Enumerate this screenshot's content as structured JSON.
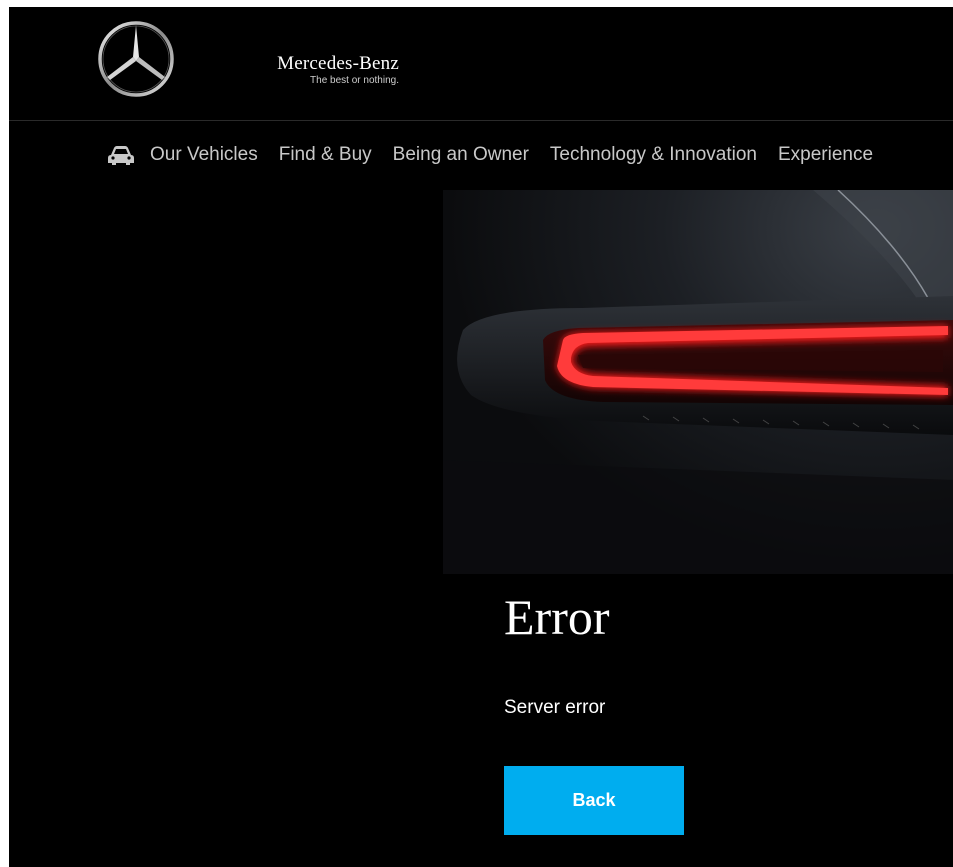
{
  "header": {
    "brand_name": "Mercedes-Benz",
    "slogan": "The best or nothing.",
    "logo_icon": "mercedes-star-icon"
  },
  "nav": {
    "icon": "car-icon",
    "items": [
      {
        "label": "Our Vehicles"
      },
      {
        "label": "Find & Buy"
      },
      {
        "label": "Being an Owner"
      },
      {
        "label": "Technology & Innovation"
      },
      {
        "label": "Experience"
      }
    ]
  },
  "hero": {
    "image": "car-taillight-image"
  },
  "error": {
    "title": "Error",
    "message": "Server error",
    "back_label": "Back"
  },
  "colors": {
    "background": "#000000",
    "accent": "#00adef",
    "text": "#ffffff",
    "nav_text": "#c8c8c8",
    "taillight": "#ff1a1a"
  }
}
